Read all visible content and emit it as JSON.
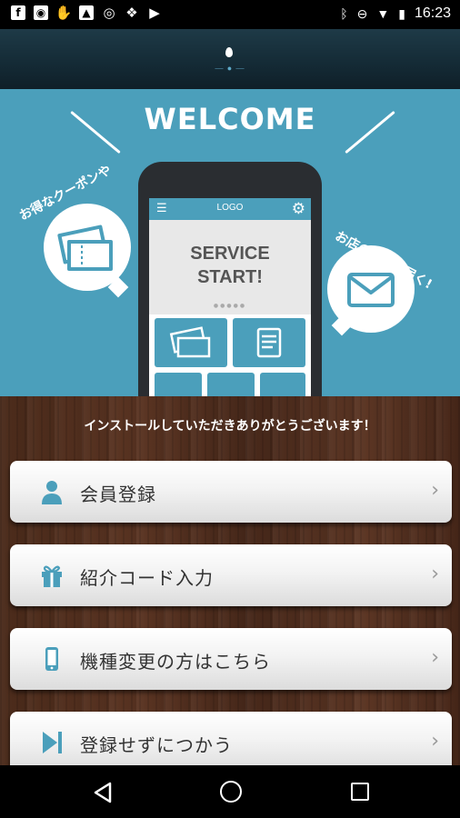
{
  "status_bar": {
    "time": "16:23",
    "icons": [
      "facebook-icon",
      "line-icon",
      "hand-icon",
      "image-icon",
      "instagram-icon",
      "dropbox-icon",
      "brand-icon",
      "bluetooth-icon",
      "do-not-disturb-icon",
      "wifi-icon",
      "battery-icon"
    ]
  },
  "header": {
    "logo_icon": "drop-icon"
  },
  "hero": {
    "welcome": "WELCOME",
    "phone": {
      "logo": "LOGO",
      "service_line1": "SERVICE",
      "service_line2": "START!"
    },
    "bubble_left_text": "お得なクーポンや",
    "bubble_right_text": "お店の情報が届く!"
  },
  "thanks_message": "インストールしていただきありがとうございます！",
  "menu": [
    {
      "label": "会員登録",
      "icon": "person-icon"
    },
    {
      "label": "紹介コード入力",
      "icon": "gift-icon"
    },
    {
      "label": "機種変更の方はこちら",
      "icon": "smartphone-icon"
    },
    {
      "label": "登録せずにつかう",
      "icon": "skip-icon"
    }
  ],
  "colors": {
    "accent": "#4b9fbb",
    "header": "#142a35",
    "wood": "#4a2a1a"
  }
}
